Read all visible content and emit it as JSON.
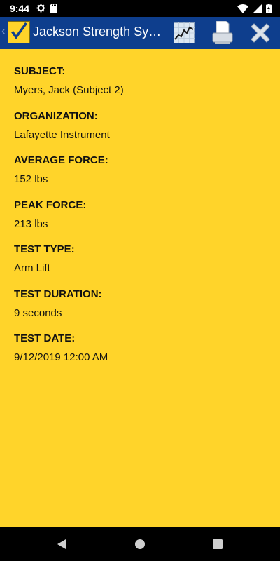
{
  "status_bar": {
    "time": "9:44",
    "left_icons": [
      "gear-icon",
      "sd-card-icon"
    ],
    "right_icons": [
      "wifi-icon",
      "signal-icon",
      "battery-icon"
    ]
  },
  "app_bar": {
    "title": "Jackson Strength System",
    "actions": [
      "graph-icon",
      "print-icon",
      "close-icon"
    ],
    "colors": {
      "background": "#0E3E8D",
      "accent": "#FFD42A"
    }
  },
  "fields": [
    {
      "label": "SUBJECT:",
      "value": "Myers, Jack (Subject 2)"
    },
    {
      "label": "ORGANIZATION:",
      "value": "Lafayette Instrument"
    },
    {
      "label": "AVERAGE FORCE:",
      "value": "152 lbs"
    },
    {
      "label": "PEAK FORCE:",
      "value": "213 lbs"
    },
    {
      "label": "TEST TYPE:",
      "value": "Arm Lift"
    },
    {
      "label": "TEST DURATION:",
      "value": "9 seconds"
    },
    {
      "label": "TEST DATE:",
      "value": "9/12/2019 12:00 AM"
    }
  ],
  "nav_bar": {
    "buttons": [
      "back-triangle-icon",
      "home-circle-icon",
      "recents-square-icon"
    ]
  }
}
